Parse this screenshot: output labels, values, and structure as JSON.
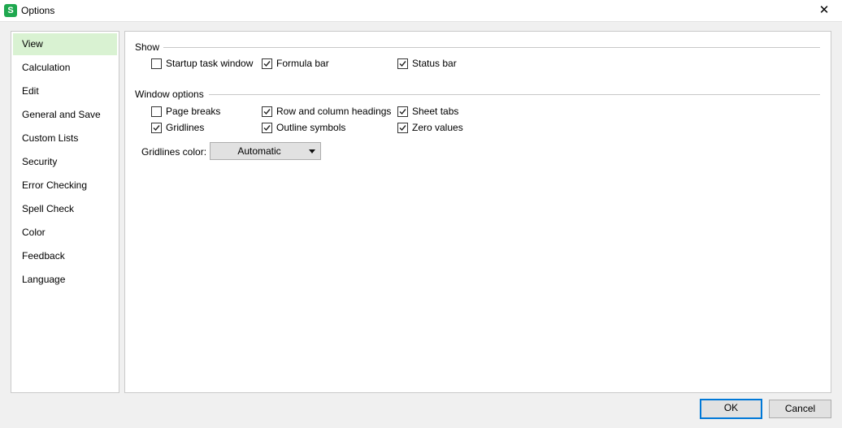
{
  "window": {
    "title": "Options",
    "logo_letter": "S",
    "close_glyph": "✕"
  },
  "sidebar": {
    "items": [
      {
        "label": "View",
        "selected": true
      },
      {
        "label": "Calculation"
      },
      {
        "label": "Edit"
      },
      {
        "label": "General and Save"
      },
      {
        "label": "Custom Lists"
      },
      {
        "label": "Security"
      },
      {
        "label": "Error Checking"
      },
      {
        "label": "Spell Check"
      },
      {
        "label": "Color"
      },
      {
        "label": "Feedback"
      },
      {
        "label": "Language"
      }
    ]
  },
  "show": {
    "title": "Show",
    "options": [
      {
        "label": "Startup task window",
        "checked": false
      },
      {
        "label": "Formula bar",
        "checked": true
      },
      {
        "label": "Status bar",
        "checked": true
      }
    ]
  },
  "window_options": {
    "title": "Window options",
    "options": [
      {
        "label": "Page breaks",
        "checked": false
      },
      {
        "label": "Row and column headings",
        "checked": true
      },
      {
        "label": "Sheet tabs",
        "checked": true
      },
      {
        "label": "Gridlines",
        "checked": true
      },
      {
        "label": "Outline symbols",
        "checked": true
      },
      {
        "label": "Zero values",
        "checked": true
      }
    ],
    "gridlines_color_label": "Gridlines color:",
    "gridlines_color_value": "Automatic"
  },
  "buttons": {
    "ok": "OK",
    "cancel": "Cancel"
  },
  "colors": {
    "accent": "#0078d7",
    "selected_nav": "#d9f2d2",
    "logo": "#1fa84f"
  }
}
